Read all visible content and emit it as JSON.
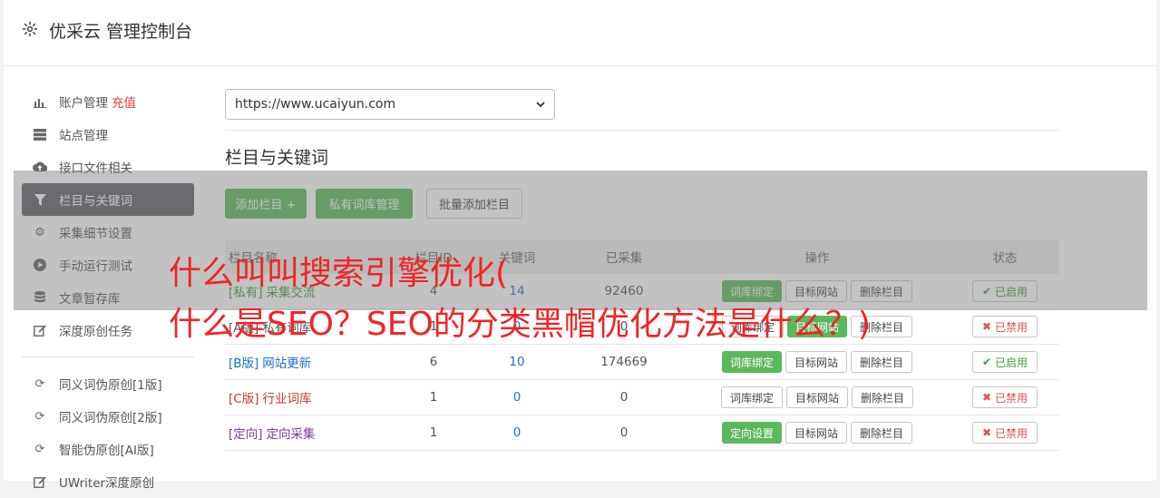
{
  "app": {
    "title": "优采云 管理控制台"
  },
  "sidebar": {
    "items": [
      {
        "label": "账户管理",
        "extra": "充值",
        "icon": "bar-chart-icon"
      },
      {
        "label": "站点管理",
        "icon": "server-icon"
      },
      {
        "label": "接口文件相关",
        "icon": "cloud-upload-icon"
      },
      {
        "label": "栏目与关键词",
        "icon": "filter-icon"
      },
      {
        "label": "采集细节设置",
        "icon": "gears-icon"
      },
      {
        "label": "手动运行测试",
        "icon": "play-circle-icon"
      },
      {
        "label": "文章暂存库",
        "icon": "database-icon"
      },
      {
        "label": "深度原创任务",
        "icon": "edit-icon"
      },
      {
        "label": "同义词伪原创[1版]",
        "icon": "refresh-icon"
      },
      {
        "label": "同义词伪原创[2版]",
        "icon": "refresh-icon"
      },
      {
        "label": "智能伪原创[AI版]",
        "icon": "refresh-icon"
      },
      {
        "label": "UWriter深度原创",
        "icon": "edit-icon"
      }
    ]
  },
  "site_select": {
    "value": "https://www.ucaiyun.com"
  },
  "section": {
    "title": "栏目与关键词",
    "add_column": "添加栏目 +",
    "private_lib": "私有词库管理",
    "batch_add": "批量添加栏目"
  },
  "table": {
    "headers": [
      "栏目名称",
      "栏目ID",
      "关键词",
      "已采集",
      "操作",
      "状态"
    ],
    "rows": [
      {
        "tag": "[私有]",
        "name": "采集交流",
        "id": "4",
        "kw": "14",
        "collected": "92460",
        "op1": "词库绑定",
        "op2": "目标网站",
        "op3": "删除栏目",
        "status": "已启用"
      },
      {
        "tag": "[A版]",
        "name": "私有词库",
        "id": "1",
        "kw": "0",
        "collected": "0",
        "op1": "词库绑定",
        "op2": "目标网站",
        "op3": "删除栏目",
        "status": "已禁用"
      },
      {
        "tag": "[B版]",
        "name": "网站更新",
        "id": "6",
        "kw": "10",
        "collected": "174669",
        "op1": "词库绑定",
        "op2": "目标网站",
        "op3": "删除栏目",
        "status": "已启用"
      },
      {
        "tag": "[C版]",
        "name": "行业词库",
        "id": "1",
        "kw": "0",
        "collected": "0",
        "op1": "词库绑定",
        "op2": "目标网站",
        "op3": "删除栏目",
        "status": "已禁用"
      },
      {
        "tag": "[定向]",
        "name": "定向采集",
        "id": "1",
        "kw": "0",
        "collected": "0",
        "op1": "定向设置",
        "op2": "目标网站",
        "op3": "删除栏目",
        "status": "已禁用"
      }
    ]
  },
  "overlay": {
    "line1": "什么叫叫搜索引擎优化(",
    "line2": "什么是SEO？SEO的分类黑帽优化方法是什么？)"
  },
  "colors": {
    "accent_green": "#5cb85c",
    "active_nav": "#5d6268",
    "red": "#f02525"
  }
}
